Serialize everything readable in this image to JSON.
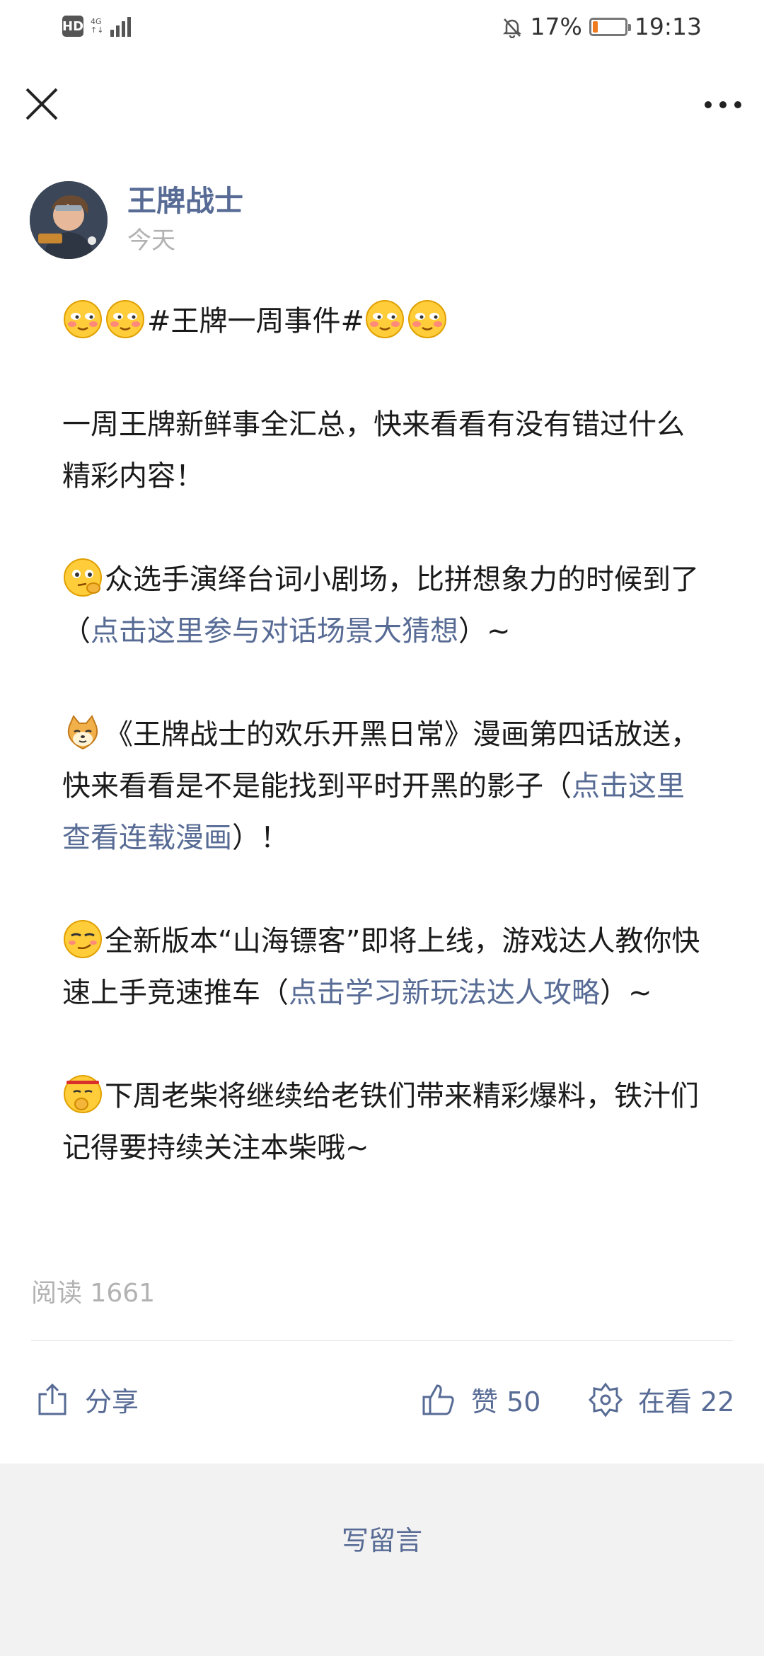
{
  "status_bar": {
    "hd_label": "HD",
    "network": "4G",
    "battery_percent": 17,
    "battery_text": "17%",
    "time": "19:13"
  },
  "nav": {
    "close_icon": "close-icon",
    "more_icon": "more-icon"
  },
  "author": {
    "name": "王牌战士",
    "date": "今天"
  },
  "article": {
    "headline": "#王牌一周事件#",
    "intro": "一周王牌新鲜事全汇总，快来看看有没有错过什么精彩内容！",
    "item1_text": "众选手演绎台词小剧场，比拼想象力的时候到了（",
    "item1_link": "点击这里参与对话场景大猜想",
    "item1_tail": "）~",
    "item2_text": "《王牌战士的欢乐开黑日常》漫画第四话放送，快来看看是不是能找到平时开黑的影子（",
    "item2_link": "点击这里查看连载漫画",
    "item2_tail": "）！",
    "item3_text": "全新版本“山海镖客”即将上线，游戏达人教你快速上手竞速推车（",
    "item3_link": "点击学习新玩法达人攻略",
    "item3_tail": "）~",
    "item4_text": "下周老柴将继续给老铁们带来精彩爆料，铁汁们记得要持续关注本柴哦~"
  },
  "stats": {
    "reads": "阅读 1661"
  },
  "actions": {
    "share_label": "分享",
    "like_label": "赞 50",
    "wow_label": "在看 22"
  },
  "comment": {
    "write_label": "写留言"
  },
  "colors": {
    "link": "#576b95",
    "muted": "#b2b2b2",
    "comment_bg": "#f2f2f2"
  }
}
